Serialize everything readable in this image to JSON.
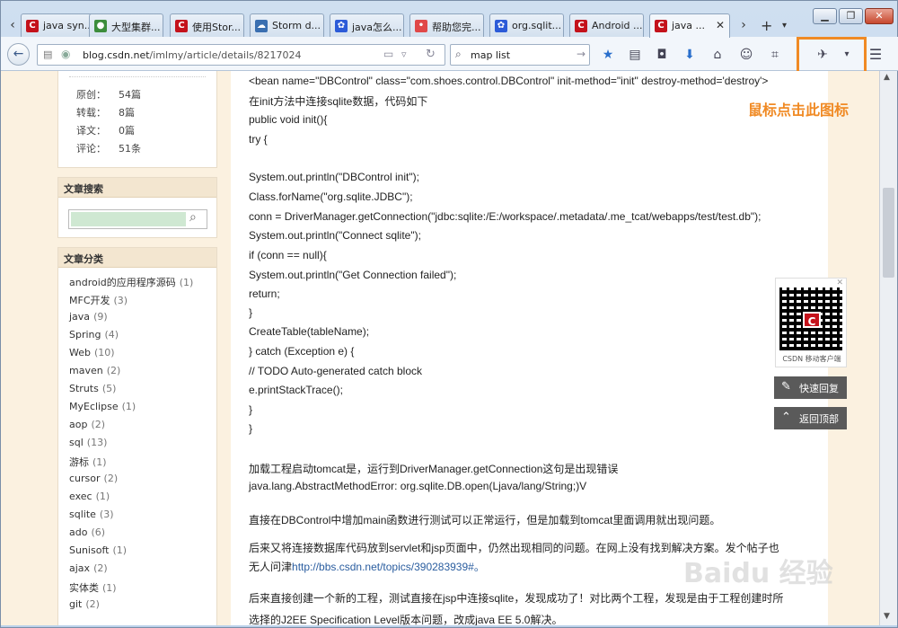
{
  "tabs": [
    {
      "label": "java syn...",
      "color": "#c4121b"
    },
    {
      "label": "大型集群...",
      "color": "#3c8d3c"
    },
    {
      "label": "使用Stor...",
      "color": "#c4121b"
    },
    {
      "label": "Storm d...",
      "color": "#3a6fb0"
    },
    {
      "label": "java怎么...",
      "color": "#2c5bd8"
    },
    {
      "label": "帮助您完...",
      "color": "#e04848"
    },
    {
      "label": "org.sqlit...",
      "color": "#2c5bd8"
    },
    {
      "label": "Android ...",
      "color": "#c4121b"
    },
    {
      "label": "java ...",
      "color": "#c4121b"
    }
  ],
  "navbar": {
    "url_host": "blog.csdn.net",
    "url_path": "/imlmy/article/details/8217024",
    "search_query": "map list"
  },
  "stats": [
    {
      "label": "原创：",
      "value": "54篇"
    },
    {
      "label": "转载：",
      "value": "8篇"
    },
    {
      "label": "译文：",
      "value": "0篇"
    },
    {
      "label": "评论：",
      "value": "51条"
    }
  ],
  "search_box": {
    "title": "文章搜索"
  },
  "categories_box": {
    "title": "文章分类"
  },
  "categories": [
    {
      "name": "android的应用程序源码",
      "count": "(1)"
    },
    {
      "name": "MFC开发",
      "count": "(3)"
    },
    {
      "name": "java",
      "count": "(9)"
    },
    {
      "name": "Spring",
      "count": "(4)"
    },
    {
      "name": "Web",
      "count": "(10)"
    },
    {
      "name": "maven",
      "count": "(2)"
    },
    {
      "name": "Struts",
      "count": "(5)"
    },
    {
      "name": "MyEclipse",
      "count": "(1)"
    },
    {
      "name": "aop",
      "count": "(2)"
    },
    {
      "name": "sql",
      "count": "(13)"
    },
    {
      "name": "游标",
      "count": "(1)"
    },
    {
      "name": "cursor",
      "count": "(2)"
    },
    {
      "name": "exec",
      "count": "(1)"
    },
    {
      "name": "sqlite",
      "count": "(3)"
    },
    {
      "name": "ado",
      "count": "(6)"
    },
    {
      "name": "Sunisoft",
      "count": "(1)"
    },
    {
      "name": "ajax",
      "count": "(2)"
    },
    {
      "name": "实体类",
      "count": "(1)"
    },
    {
      "name": "git",
      "count": "(2)"
    }
  ],
  "article_lines": [
    "<bean name=\"DBControl\" class=\"com.shoes.control.DBControl\" init-method=\"init\" destroy-method='destroy'>",
    "在init方法中连接sqlite数据，代码如下",
    "public void init(){",
    "try {",
    "System.out.println(\"DBControl init\");",
    "Class.forName(\"org.sqlite.JDBC\");",
    "conn = DriverManager.getConnection(\"jdbc:sqlite:/E:/workspace/.metadata/.me_tcat/webapps/test/test.db\");",
    "System.out.println(\"Connect sqlite\");",
    "if (conn == null){",
    "System.out.println(\"Get Connection failed\");",
    "return;",
    "}",
    "CreateTable(tableName);",
    "} catch (Exception e) {",
    "// TODO Auto-generated catch block",
    "e.printStackTrace();",
    "}",
    "}",
    "加载工程启动tomcat是，运行到DriverManager.getConnection这句是出现错误",
    "java.lang.AbstractMethodError: org.sqlite.DB.open(Ljava/lang/String;)V",
    "直接在DBControl中增加main函数进行测试可以正常运行，但是加载到tomcat里面调用就出现问题。",
    "后来又将连接数据库代码放到servlet和jsp页面中，仍然出现相同的问题。在网上没有找到解决方案。发个帖子也",
    "无人问津",
    "http://bbs.csdn.net/topics/390283939#。",
    "后来直接创建一个新的工程，测试直接在jsp中连接sqlite，发现成功了！对比两个工程，发现是由于工程创建时所",
    "选择的J2EE Specification Level版本问题，改成java EE 5.0解决。"
  ],
  "annotation": "鼠标点击此图标",
  "qr_caption": "CSDN 移动客户端",
  "qr_logo": "C",
  "side_buttons": {
    "reply": "快速回复",
    "top": "返回顶部"
  },
  "watermark": "Baidu 经验",
  "colors": {
    "accent_orange": "#f08a24",
    "csdn_red": "#c4121b",
    "page_bg": "#fbf1e0"
  }
}
